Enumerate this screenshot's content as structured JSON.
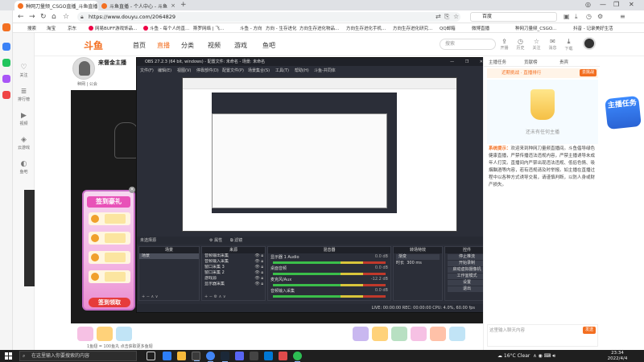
{
  "browser": {
    "tabs": [
      {
        "title": "种网刀量频_CSGO直播_斗鱼直播",
        "active": true
      },
      {
        "title": "斗鱼直播 - 个人中心 - 斗鱼",
        "active": false
      }
    ],
    "url": "https://www.douyu.com/2064829",
    "url_search_engine": "百度",
    "bookmarks": [
      "搜索",
      "淘宝",
      "京东",
      "网易BUFF游戏饰品...",
      "斗鱼 - 每个人的直...",
      "斯罗网络 | 飞...",
      "斗鱼 - 方向",
      "方向 - 生存进化",
      "方向生存进化物品...",
      "方向生存进化手机...",
      "方向生存进化研究...",
      "QQ邮箱",
      "微博直播",
      "种网刀量频_CSGO...",
      "抖音 - 记录美好生活"
    ]
  },
  "douyu_sidebar": [
    {
      "icon": "home-icon",
      "label": "关注"
    },
    {
      "icon": "list-icon",
      "label": "排行榜"
    },
    {
      "icon": "video-icon",
      "label": "视频"
    },
    {
      "icon": "game-icon",
      "label": "云游戏"
    },
    {
      "icon": "fish-icon",
      "label": "鱼吧"
    }
  ],
  "topnav": {
    "logo": "斗鱼",
    "links": [
      "首页",
      "直播",
      "分类",
      "视频",
      "游戏",
      "鱼吧"
    ],
    "active_link": "直播",
    "search_placeholder": "搜索",
    "icons": [
      {
        "icon": "upload-icon",
        "label": "开播"
      },
      {
        "icon": "history-icon",
        "label": "历史"
      },
      {
        "icon": "star-icon",
        "label": "关注"
      },
      {
        "icon": "message-icon",
        "label": "消息"
      },
      {
        "icon": "download-icon",
        "label": "下载"
      }
    ]
  },
  "streamer": {
    "name": "来督金主播",
    "meta": "种网 | 公会"
  },
  "promo": {
    "title": "签到豪礼",
    "claim": "签到领取",
    "days": 4
  },
  "giftbar": {
    "note": "1鱼翅 = 100鱼丸  点击获取更多鱼翅"
  },
  "chat": {
    "tabs": [
      "主播任务",
      "贡献榜",
      "贵宾"
    ],
    "banner_text": "近期挑战 · 直播排行",
    "banner_button": "去挑战",
    "rank_text": "还未有任何主播",
    "notice_label": "系统提示：",
    "notice": "欢迎来到种网刀量频直播间。斗鱼倡导绿色健康直播，严禁传播违法违规内容，严禁主播诱导未成年人打赏。直播间内严禁出现违法违规、低俗色情、吸烟酗酒等内容，若有违规请及时举报。如主播在直播过程中以各种方式诱导交易，请谨慎判断，以防人身或财产损失。",
    "input_placeholder": "这里输入聊天内容",
    "send": "发送"
  },
  "farright_badge": "主播任务",
  "obs": {
    "title": "OBS 27.2.3 (64 bit, windows) - 配置文件: 未命名 - 场景: 未命名",
    "menu": [
      "文件(F)",
      "编辑(E)",
      "视图(V)",
      "停靠部件(D)",
      "配置文件(P)",
      "场景集合(S)",
      "工具(T)",
      "帮助(H)",
      "斗鱼-共同体"
    ],
    "no_source": "未选择源",
    "bar_buttons": [
      "属性",
      "滤镜"
    ],
    "scenes_header": "场景",
    "scenes": [
      "场景"
    ],
    "sources_header": "来源",
    "sources": [
      "音频输出采集",
      "音频输入采集",
      "窗口采集 3",
      "窗口采集 2",
      "游戏源",
      "显示器采集"
    ],
    "mixer_header": "混音器",
    "mixer": [
      {
        "name": "显示器 1 Audio",
        "db": "0.0 dB"
      },
      {
        "name": "桌面音频",
        "db": "0.0 dB"
      },
      {
        "name": "麦克风/Aux",
        "db": "-12.2 dB"
      },
      {
        "name": "音频输入采集",
        "db": "0.0 dB"
      }
    ],
    "transition_header": "转场特效",
    "transition_type": "渐变",
    "transition_duration_label": "时长",
    "transition_duration": "300 ms",
    "controls_header": "控件",
    "controls": [
      "停止推流",
      "开始录制",
      "启动虚拟摄像机",
      "工作室模式",
      "设置",
      "退出"
    ],
    "status": "LIVE: 00:00:00   REC: 00:00:00   CPU: 4.0%, 60.00 fps"
  },
  "taskbar": {
    "search_placeholder": "在这里输入你要搜索的内容",
    "weather": "16°C Clear",
    "time": "23:34",
    "date": "2022/4/4"
  }
}
